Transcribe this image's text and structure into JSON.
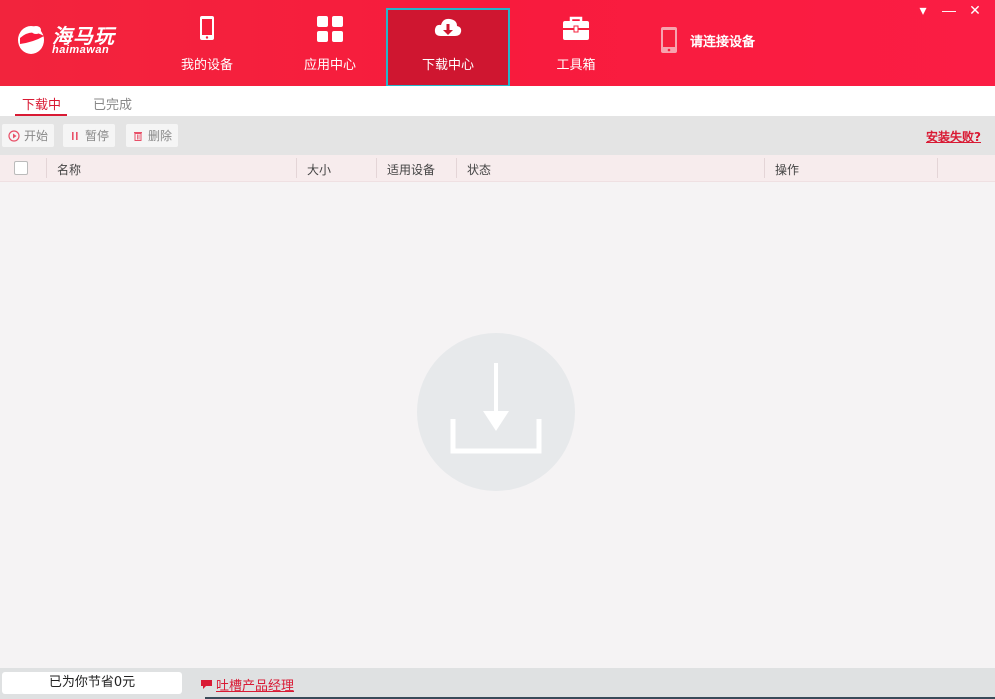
{
  "app": {
    "logo_text": "海马玩",
    "logo_sub": "haimawan"
  },
  "nav": [
    {
      "label": "我的设备",
      "icon": "phone-icon"
    },
    {
      "label": "应用中心",
      "icon": "grid-icon"
    },
    {
      "label": "下载中心",
      "icon": "cloud-download-icon",
      "active": true
    },
    {
      "label": "工具箱",
      "icon": "toolbox-icon"
    }
  ],
  "device": {
    "label": "请连接设备",
    "icon": "phone-icon"
  },
  "window": {
    "menu": "▾",
    "minimize": "—",
    "close": "✕"
  },
  "subtabs": {
    "downloading": "下载中",
    "completed": "已完成"
  },
  "toolbar": {
    "start": "开始",
    "pause": "暂停",
    "delete": "删除",
    "install_fail": "安装失败?"
  },
  "table": {
    "columns": {
      "name": "名称",
      "size": "大小",
      "device": "适用设备",
      "status": "状态",
      "action": "操作"
    }
  },
  "footer": {
    "saved": "已为你节省0元",
    "feedback": "吐槽产品经理"
  },
  "colors": {
    "brand": "#f81b3d",
    "active_nav": "#cf1630",
    "accent_border": "#27b5c9"
  }
}
